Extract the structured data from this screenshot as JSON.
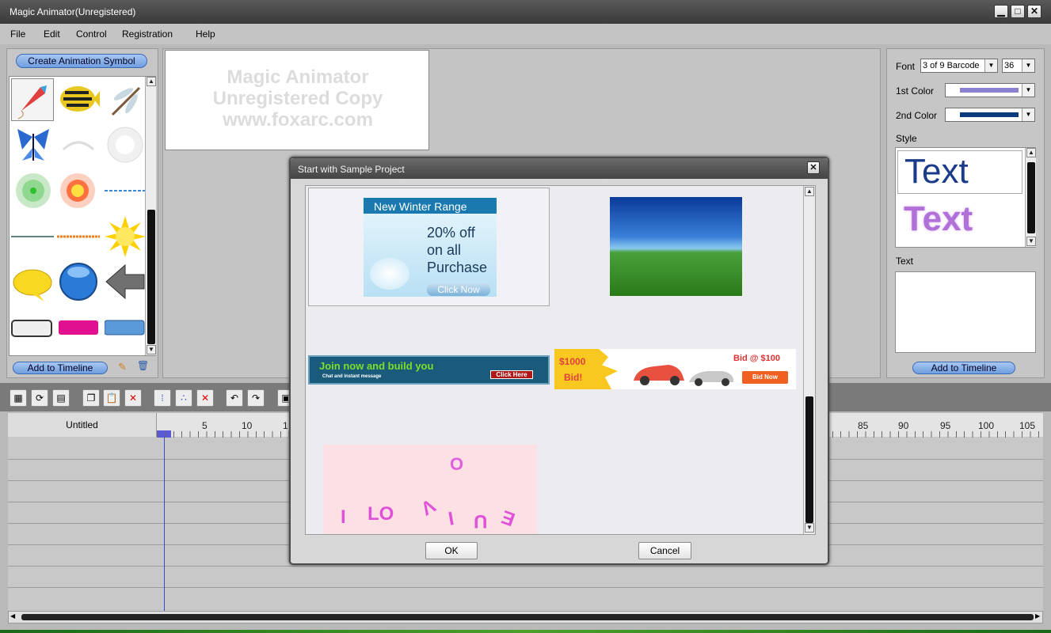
{
  "window": {
    "title": "Magic Animator(Unregistered)",
    "min": "▁",
    "max": "□",
    "close": "✕"
  },
  "menu": {
    "items": [
      "File",
      "Edit",
      "Control",
      "Registration",
      "Help"
    ]
  },
  "left_panel": {
    "create_button": "Create Animation Symbol",
    "add_button": "Add to Timeline"
  },
  "canvas": {
    "watermark": [
      "Magic Animator",
      "Unregistered Copy",
      "www.foxarc.com"
    ]
  },
  "right_panel": {
    "font_label": "Font",
    "font_value": "3 of 9 Barcode",
    "size_value": "36",
    "color1_label": "1st Color",
    "color1": "#8a82d0",
    "color2_label": "2nd Color",
    "color2": "#0d3a7a",
    "style_label": "Style",
    "style_samples": [
      "Text",
      "Text"
    ],
    "text_label": "Text",
    "add_button": "Add to Timeline"
  },
  "timeline": {
    "track_name": "Untitled",
    "ticks_left": [
      "5",
      "10",
      "1"
    ],
    "ticks_right": [
      "85",
      "90",
      "95",
      "100",
      "105"
    ]
  },
  "dialog": {
    "title": "Start with Sample Project",
    "close": "✕",
    "ok": "OK",
    "cancel": "Cancel",
    "samples": {
      "winter": {
        "header": "New Winter Range",
        "line1": "20% off",
        "line2": "on all",
        "line3": "Purchase",
        "button": "Click Now"
      },
      "join": {
        "headline": "Join now and build you",
        "sub": "Chat and instant message",
        "button": "Click Here"
      },
      "cars": {
        "price": "$1000",
        "bid": "Bid!",
        "right": "Bid @ $100",
        "button": "Bid Now"
      },
      "love": {
        "top": "O",
        "letters": [
          "I",
          "LO",
          "V",
          "I",
          "U",
          "E"
        ]
      }
    }
  }
}
